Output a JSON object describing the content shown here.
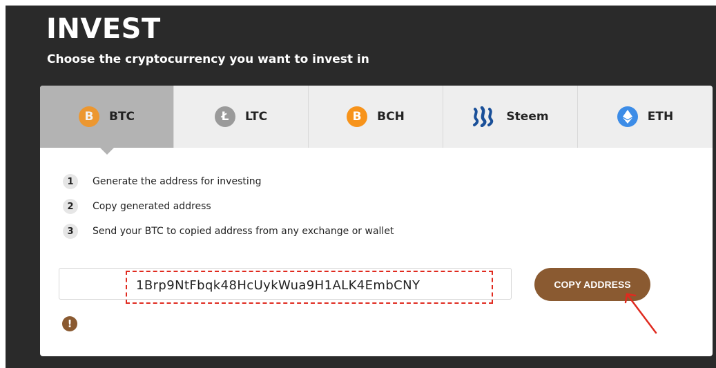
{
  "header": {
    "title": "INVEST",
    "subtitle": "Choose the cryptocurrency you want to invest in"
  },
  "tabs": [
    {
      "label": "BTC",
      "icon": "bitcoin-icon",
      "icon_glyph": "B",
      "color": "#f7931a",
      "active": true
    },
    {
      "label": "LTC",
      "icon": "litecoin-icon",
      "icon_glyph": "Ł",
      "color": "#9a9a9a",
      "active": false
    },
    {
      "label": "BCH",
      "icon": "bitcoin-cash-icon",
      "icon_glyph": "B",
      "color": "#f7931a",
      "active": false
    },
    {
      "label": "Steem",
      "icon": "steem-icon",
      "color": "#1a5099",
      "active": false
    },
    {
      "label": "ETH",
      "icon": "ethereum-icon",
      "color": "#3c8ce7",
      "active": false
    }
  ],
  "steps": [
    {
      "num": "1",
      "text": "Generate the address for investing"
    },
    {
      "num": "2",
      "text": "Copy generated address"
    },
    {
      "num": "3",
      "text": "Send your BTC to copied address from any exchange or wallet"
    }
  ],
  "address": {
    "value": "1Brp9NtFbqk48HcUykWua9H1ALK4EmbCNY"
  },
  "copy_button": {
    "label": "COPY ADDRESS",
    "color": "#8a5a31"
  },
  "warning": {
    "icon": "exclamation-icon",
    "glyph": "!"
  },
  "annotation_color": "#e02a1f"
}
